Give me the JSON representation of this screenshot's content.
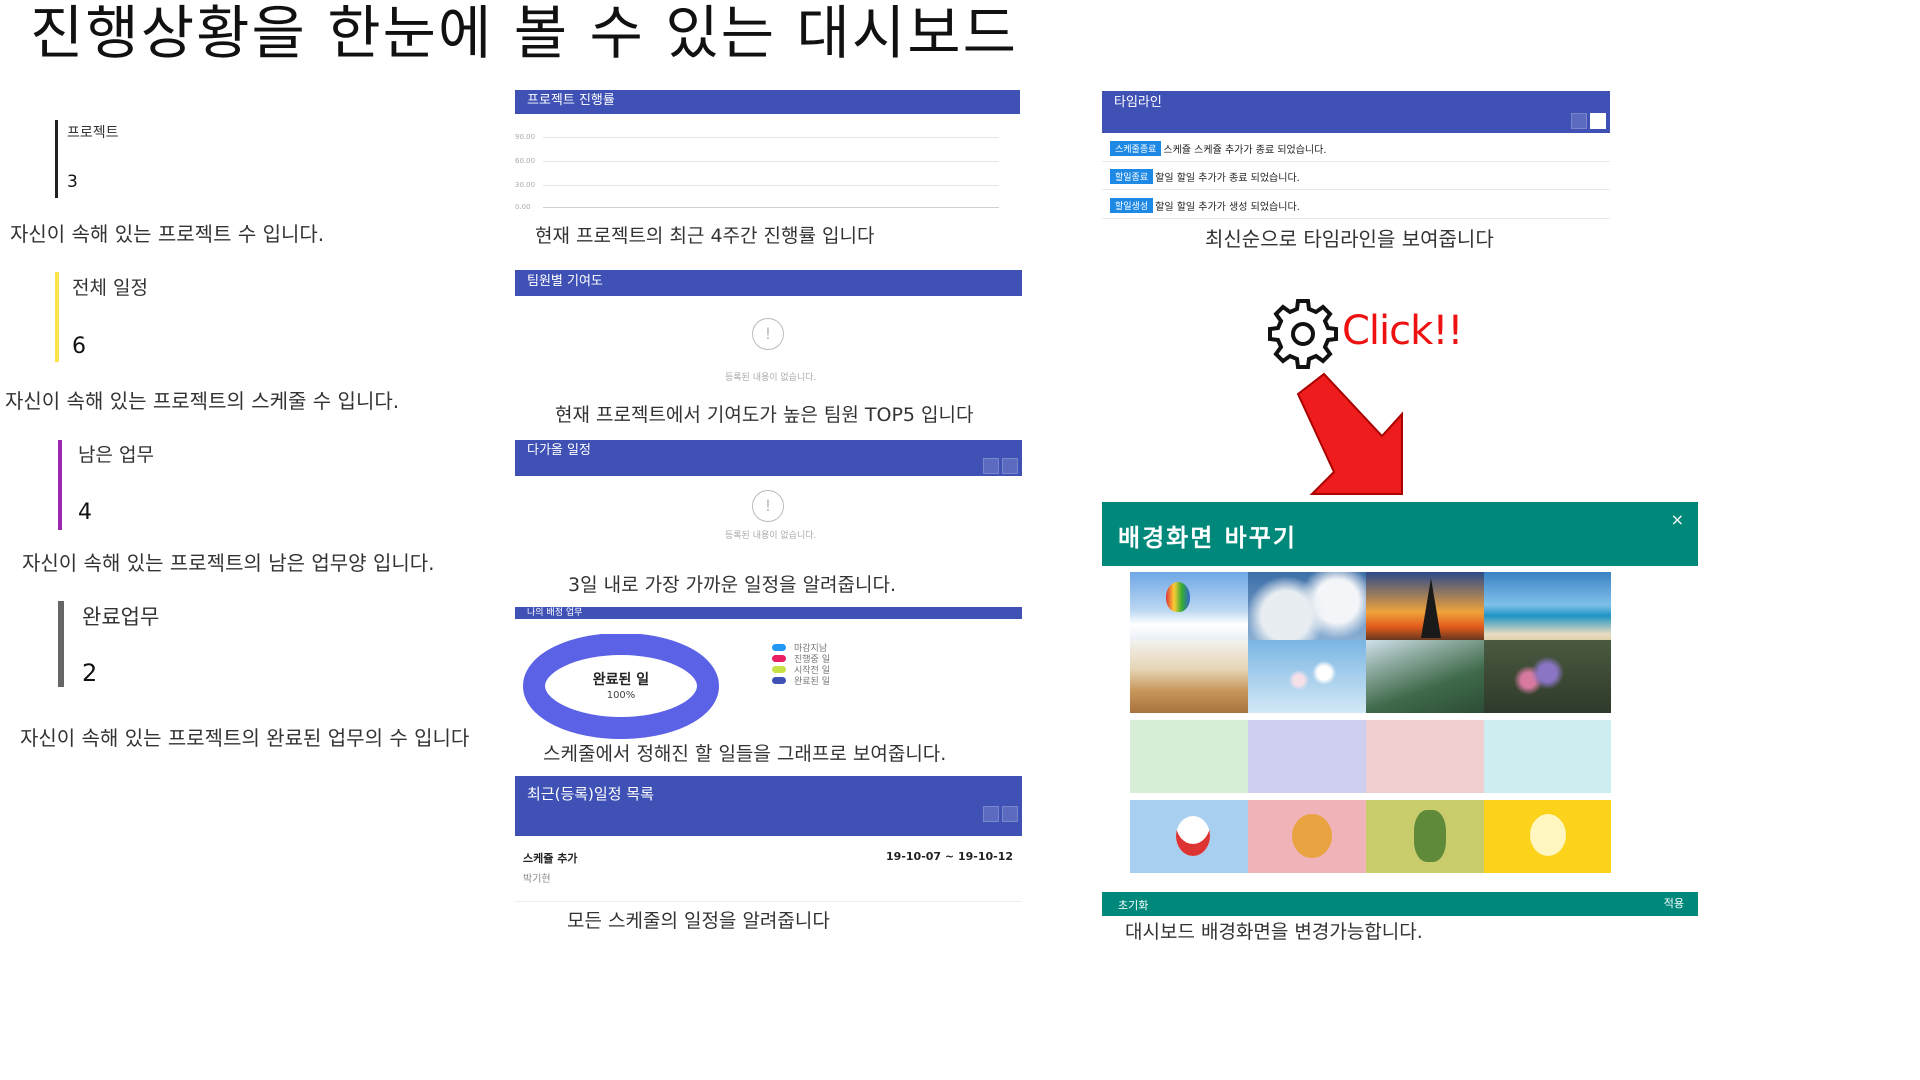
{
  "page_title": "진행상황을 한눈에 볼 수 있는 대시보드",
  "stats": [
    {
      "label": "프로젝트",
      "value": "3",
      "caption": "자신이 속해 있는 프로젝트 수 입니다.",
      "color": "#222222"
    },
    {
      "label": "전체 일정",
      "value": "6",
      "caption": "자신이 속해 있는 프로젝트의 스케줄 수 입니다.",
      "color": "#fbe34a"
    },
    {
      "label": "남은 업무",
      "value": "4",
      "caption": "자신이 속해 있는 프로젝트의 남은 업무양 입니다.",
      "color": "#9c27b0"
    },
    {
      "label": "완료업무",
      "value": "2",
      "caption": "자신이 속해 있는 프로젝트의 완료된 업무의 수 입니다",
      "color": "#666666"
    }
  ],
  "progress_panel": {
    "title": "프로젝트 진행률",
    "yticks": [
      "90.00",
      "60.00",
      "30.00",
      "0.00"
    ],
    "caption": "현재 프로젝트의 최근 4주간 진행률 입니다"
  },
  "contrib_panel": {
    "title": "팀원별 기여도",
    "empty_icon": "!",
    "empty_text": "등록된 내용이 없습니다.",
    "caption": "현재 프로젝트에서 기여도가 높은 팀원 TOP5 입니다"
  },
  "upcoming_panel": {
    "title": "다가올 일정",
    "empty_icon": "!",
    "empty_text": "등록된 내용이 없습니다.",
    "caption": "3일 내로 가장 가까운 일정을 알려줍니다."
  },
  "tasks_panel": {
    "title": "나의 배정 업무",
    "donut_label": "완료된 일",
    "donut_percent": "100%",
    "completed_fraction": 1.0,
    "legend": [
      {
        "label": "마감지남",
        "color": "#2196f3"
      },
      {
        "label": "진행중 일",
        "color": "#e91e63"
      },
      {
        "label": "시작전 일",
        "color": "#c6e246"
      },
      {
        "label": "완료된 일",
        "color": "#3f51b5"
      }
    ],
    "caption": "스케줄에서 정해진 할 일들을 그래프로 보여줍니다."
  },
  "recent_panel": {
    "title": "최근(등록)일정 목록",
    "item_title": "스케쥴 추가",
    "item_author": "박기현",
    "item_dates": "19-10-07 ~ 19-10-12",
    "caption": "모든 스케줄의 일정을 알려줍니다"
  },
  "timeline_panel": {
    "title": "타임라인",
    "rows": [
      {
        "badge": "스케줄종료",
        "text": "스케쥴 스케쥴 추가가 종료 되었습니다."
      },
      {
        "badge": "할일종료",
        "text": "할일 할일 추가가 종료 되었습니다."
      },
      {
        "badge": "할일생성",
        "text": "할일 할일 추가가 생성 되었습니다."
      }
    ],
    "caption": "최신순으로 타임라인을 보여줍니다"
  },
  "click_label": "Click!!",
  "modal": {
    "title": "배경화면 바꾸기",
    "close": "×",
    "reset": "초기화",
    "apply": "적용",
    "caption": "대시보드 배경화면을 변경가능합니다.",
    "thumbnails": [
      "hot-air-balloon-sky",
      "cloudy-sky",
      "eiffel-tower-sunset",
      "beach-sea",
      "wheat-field-trees",
      "cherry-blossom-branch",
      "mountain-valley",
      "flower-bouquet",
      "light-green",
      "lavender",
      "light-pink",
      "light-cyan",
      "character-apeach-cake",
      "character-ryan-guitar",
      "character-muzi-tree",
      "character-neo-bee"
    ],
    "solid_colors": [
      "#d6efd6",
      "#cfcff0",
      "#efcfcf",
      "#cdeef0"
    ]
  }
}
